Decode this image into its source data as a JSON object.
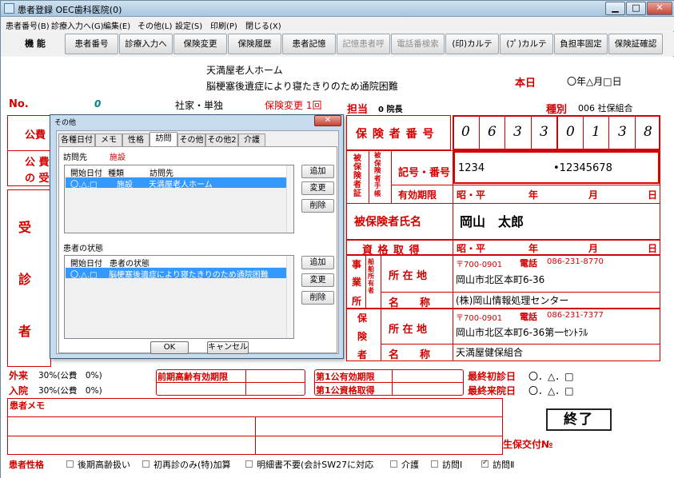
{
  "window": {
    "title": "患者登録 OEC歯科医院(0)",
    "min": "▁",
    "max": "□",
    "close": "✕"
  },
  "menu": [
    "患者番号(B)",
    "診療入力へ(G)",
    "編集(E)",
    "その他(L)",
    "設定(S)",
    "印刷(P)",
    "閉じる(X)"
  ],
  "func_label": "機 能",
  "func_buttons": [
    {
      "label": "患者番号",
      "enabled": true
    },
    {
      "label": "診療入力へ",
      "enabled": true
    },
    {
      "label": "保険変更",
      "enabled": true
    },
    {
      "label": "保険履歴",
      "enabled": true
    },
    {
      "label": "患者記憶",
      "enabled": true
    },
    {
      "label": "記憶患者呼",
      "enabled": false
    },
    {
      "label": "電話番検索",
      "enabled": false
    },
    {
      "label": "(印)カルテ",
      "enabled": true
    },
    {
      "label": "(ﾌﾟ)カルテ",
      "enabled": true
    },
    {
      "label": "負担率固定",
      "enabled": true
    },
    {
      "label": "保険証確認",
      "enabled": true
    }
  ],
  "header": {
    "facility": "天満屋老人ホーム",
    "facility_note": "脳梗塞後遺症により寝たきりのため通院困難",
    "today_label": "本日",
    "today_value": "〇年△月□日",
    "no_label": "No.",
    "no_value": "0",
    "insured_type": "社家・単独",
    "insurance_change": "保険変更 1回",
    "doctor_label": "担当",
    "doctor_value": "0 院長",
    "kind_label": "種別",
    "kind_value": "006 社保組合"
  },
  "left_labels": {
    "kouhi": "公費",
    "kouhi_recv_1": "公 費",
    "kouhi_recv_2": "の 受",
    "patient": [
      "受",
      "診",
      "者"
    ]
  },
  "insurance": {
    "insurer_no_label": "保 険 者 番 号",
    "insurer_digits": [
      "0",
      "6",
      "3",
      "3",
      "0",
      "1",
      "3",
      "8"
    ],
    "hihoken_label": "被保険者証",
    "hihoken_tetsu_label": "被保険者手帳",
    "kigou_label": "記号・番号",
    "kigou_value": "1234",
    "bangou_value": "•12345678",
    "valid_label": "有効期限",
    "valid_era": "昭・平",
    "year": "年",
    "month": "月",
    "day": "日",
    "name_label": "被保険者氏名",
    "name_value": "岡山　太郎",
    "acquire_label": "資 格 取 得",
    "acquire_era": "昭・平"
  },
  "employer": {
    "label": [
      "事",
      "業",
      "所"
    ],
    "sublabel": "船舶所有者",
    "address_label": "所 在 地",
    "postal": "〒700-0901",
    "tel_label": "電話",
    "tel": "086-231-8770",
    "address": "岡山市北区本町6-36",
    "name_label": "名　　称",
    "name": "(株)岡山情報処理センター"
  },
  "insurer": {
    "label": [
      "保",
      "険",
      "者"
    ],
    "address_label": "所 在 地",
    "postal": "〒700-0901",
    "tel_label": "電話",
    "tel": "086-231-7377",
    "address": "岡山市北区本町6-36第一ｾﾝﾄﾗﾙ",
    "name_label": "名　　称",
    "name": "天満屋健保組合"
  },
  "burden": {
    "gairai_label": "外来",
    "gairai_value": "30%(公費　0%)",
    "nyuin_label": "入院",
    "nyuin_value": "30%(公費　0%)",
    "kouki_label": "前期高齢有効期限",
    "kouhi1_valid": "第1公有効期限",
    "kouhi1_acq": "第1公資格取得",
    "first_visit_label": "最終初診日",
    "first_visit_value": "〇．△．□",
    "last_visit_label": "最終来院日",
    "last_visit_value": "〇．△．□"
  },
  "memo_label": "患者メモ",
  "seiho_label": "生保交付№",
  "finish_button": "終了",
  "traits": {
    "label": "患者性格",
    "items": [
      {
        "label": "後期高齢扱い",
        "checked": false
      },
      {
        "label": "初再診のみ(特)加算",
        "checked": false
      },
      {
        "label": "明細書不要(会計SW27に対応",
        "checked": false
      },
      {
        "label": "介護",
        "checked": false
      },
      {
        "label": "訪問Ⅰ",
        "checked": false
      },
      {
        "label": "訪問Ⅱ",
        "checked": true
      }
    ]
  },
  "dialog": {
    "title": "その他",
    "close": "✕",
    "tabs": [
      "各種日付",
      "メモ",
      "性格",
      "訪問",
      "その他",
      "その他2",
      "介護"
    ],
    "active_tab": "訪問",
    "visit_label": "訪問先",
    "visit_type": "施設",
    "visit_list": {
      "headers": [
        "開始日付",
        "種類",
        "訪問先"
      ],
      "rows": [
        {
          "date": "〇.△.□",
          "type": "施設",
          "place": "天満屋老人ホーム"
        }
      ]
    },
    "status_label": "患者の状態",
    "status_list": {
      "headers": [
        "開始日付",
        "患者の状態"
      ],
      "rows": [
        {
          "date": "〇.△.□",
          "status": "脳梗塞後遺症により寝たきりのため通院困難"
        }
      ]
    },
    "add": "追加",
    "change": "変更",
    "delete": "削除",
    "ok": "OK",
    "cancel": "キャンセル"
  }
}
